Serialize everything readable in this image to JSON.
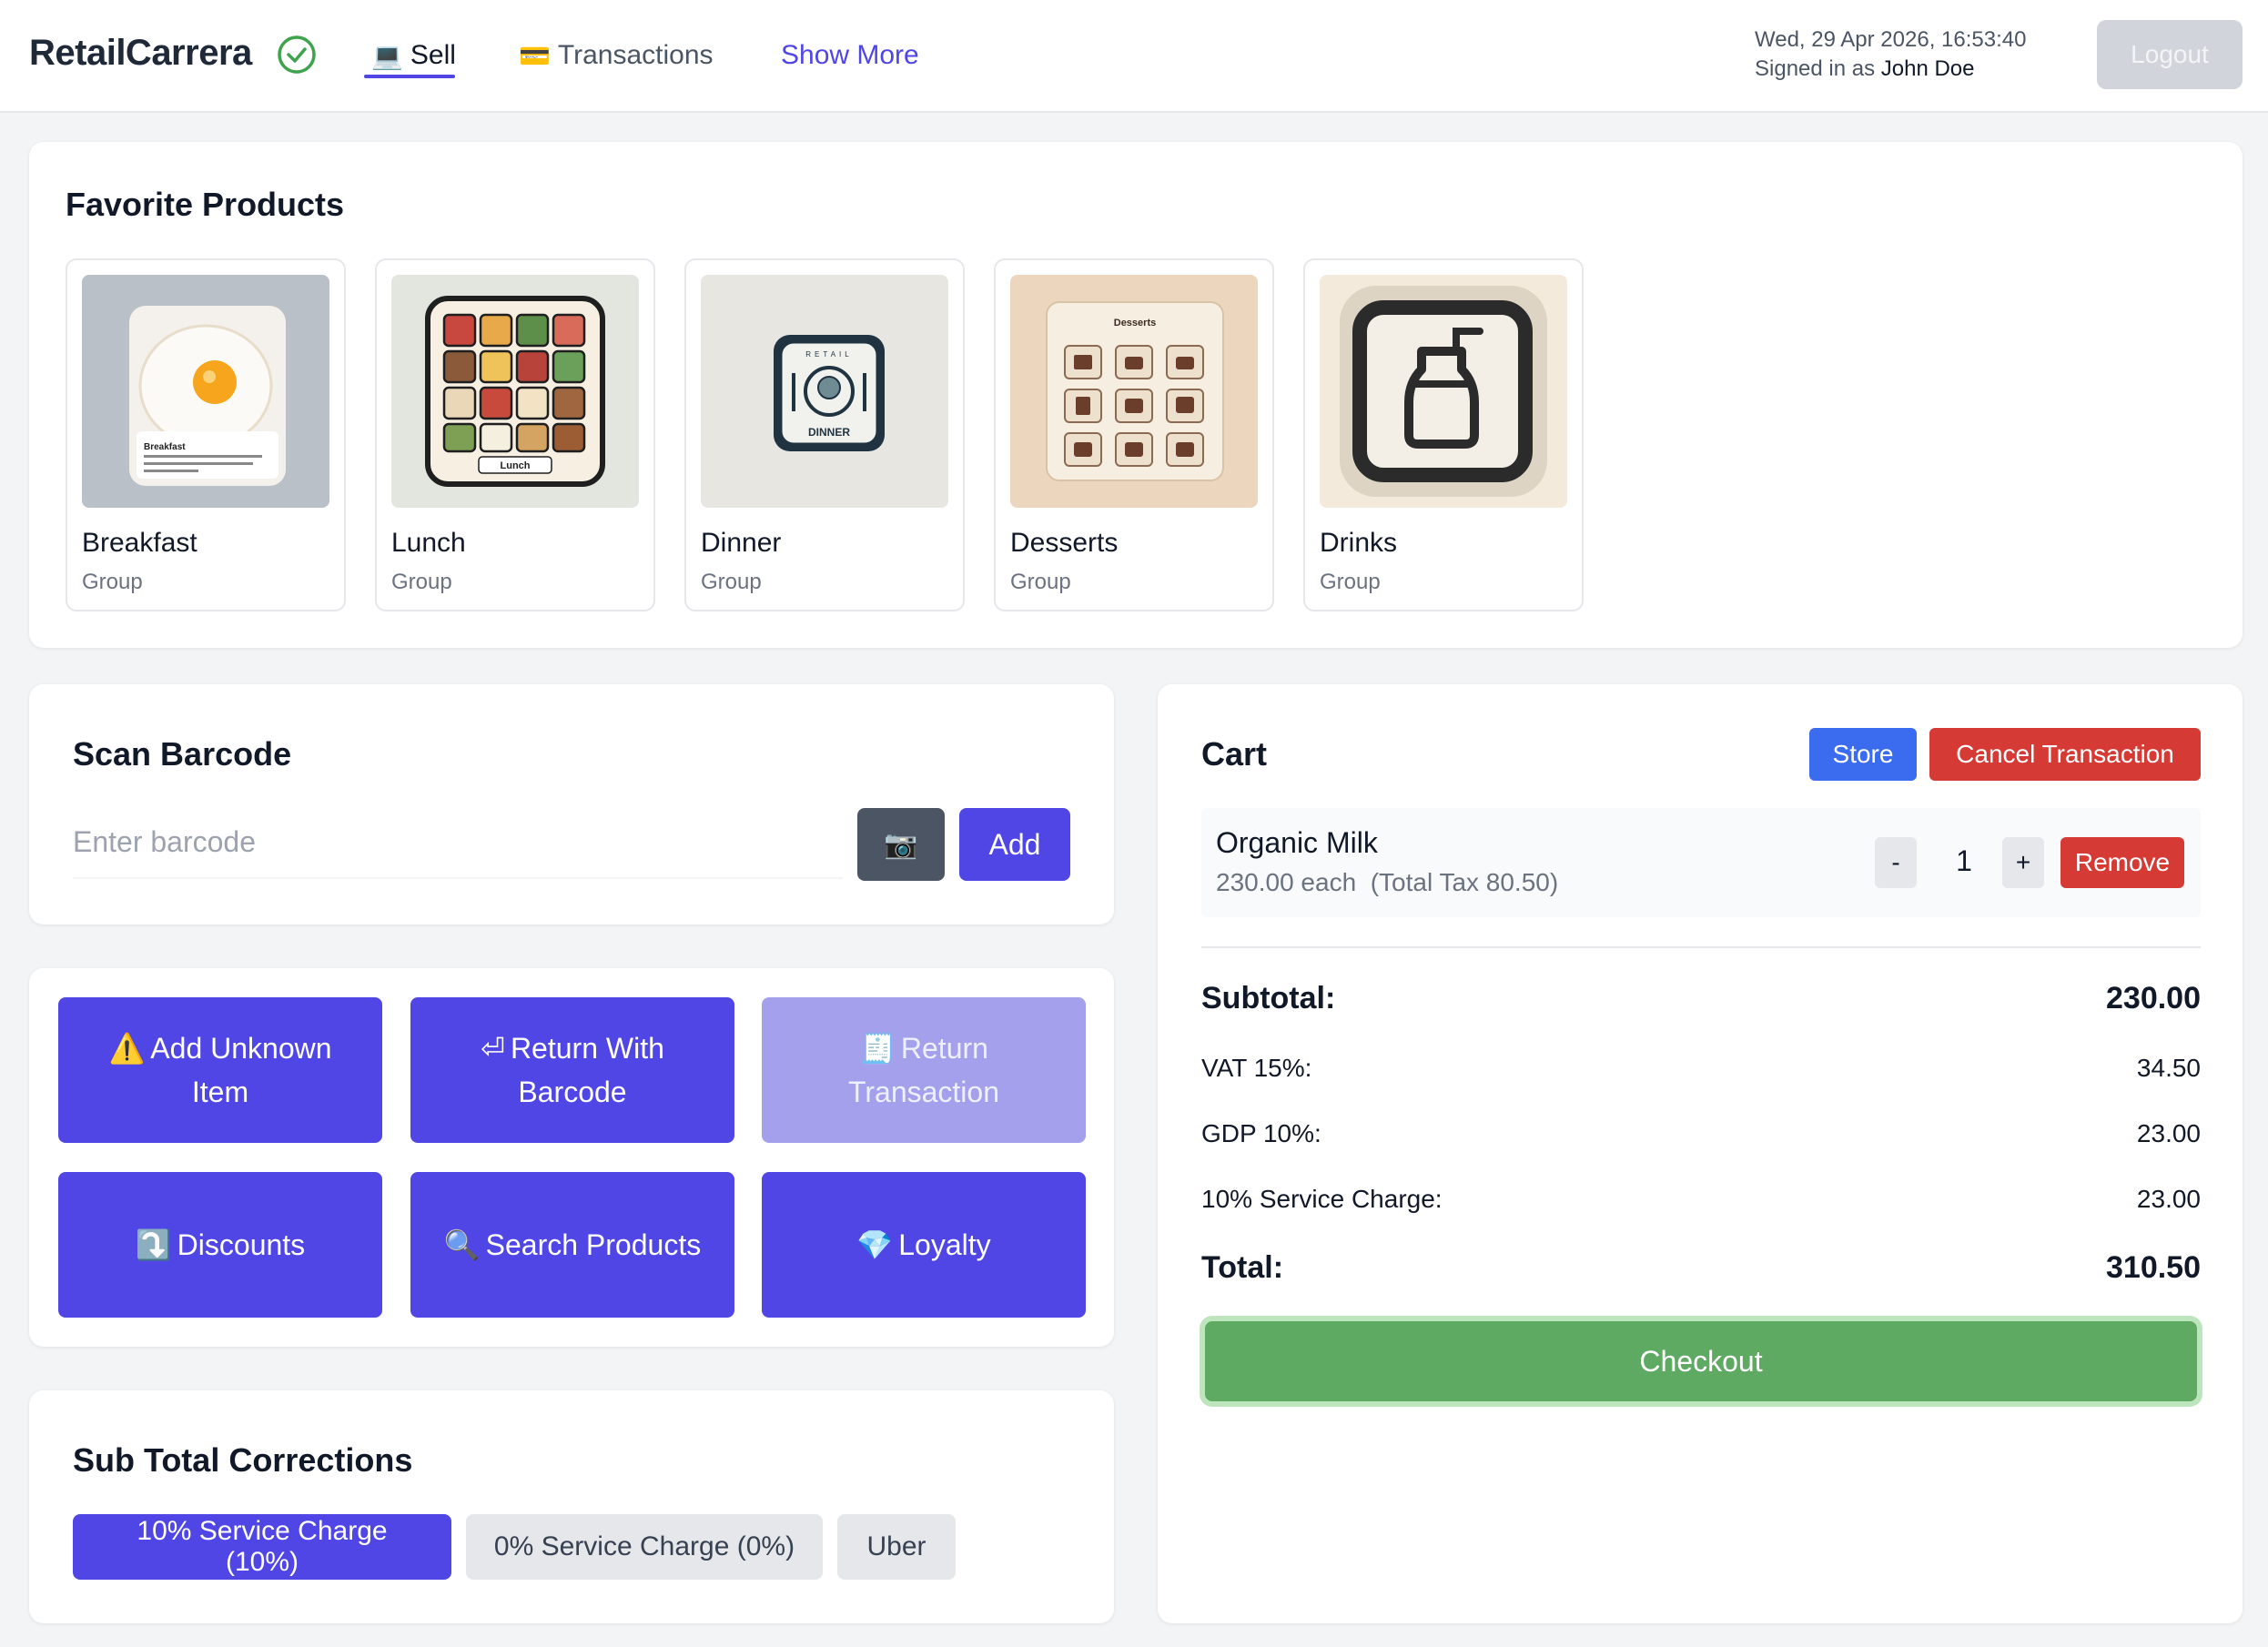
{
  "header": {
    "brand": "RetailCarrera",
    "nav": {
      "sell": {
        "icon": "💻",
        "label": "Sell"
      },
      "transactions": {
        "icon": "💳",
        "label": "Transactions"
      },
      "more": "Show More"
    },
    "datetime": "Wed, 29 Apr 2026, 16:53:40",
    "signed_prefix": "Signed in as",
    "user": "John Doe",
    "logout": "Logout"
  },
  "favorites": {
    "title": "Favorite Products",
    "items": [
      {
        "name": "Breakfast",
        "type": "Group"
      },
      {
        "name": "Lunch",
        "type": "Group"
      },
      {
        "name": "Dinner",
        "type": "Group"
      },
      {
        "name": "Desserts",
        "type": "Group"
      },
      {
        "name": "Drinks",
        "type": "Group"
      }
    ],
    "image_text": {
      "breakfast": "Breakfast",
      "lunch": "Lunch",
      "dinner_top": "RETAIL",
      "dinner": "DINNER",
      "desserts": "Desserts"
    }
  },
  "scan": {
    "title": "Scan Barcode",
    "placeholder": "Enter barcode",
    "camera_icon": "📷",
    "add": "Add"
  },
  "actions": [
    {
      "icon": "⚠️",
      "label": "Add Unknown Item"
    },
    {
      "icon": "⏎",
      "label": "Return With Barcode"
    },
    {
      "icon": "🧾",
      "label": "Return Transaction",
      "disabled": true
    },
    {
      "icon": "⤵️",
      "label": "Discounts"
    },
    {
      "icon": "🔍",
      "label": "Search Products"
    },
    {
      "icon": "💎",
      "label": "Loyalty"
    }
  ],
  "corrections": {
    "title": "Sub Total Corrections",
    "options": [
      {
        "label": "10% Service Charge (10%)",
        "active": true
      },
      {
        "label": "0% Service Charge (0%)",
        "active": false
      },
      {
        "label": "Uber",
        "active": false
      }
    ]
  },
  "cart": {
    "title": "Cart",
    "store": "Store",
    "cancel": "Cancel Transaction",
    "items": [
      {
        "name": "Organic Milk",
        "price_line": "230.00 each  (Total Tax 80.50)",
        "qty": "1",
        "minus": "-",
        "plus": "+",
        "remove": "Remove"
      }
    ],
    "summary": {
      "subtotal": {
        "label": "Subtotal:",
        "value": "230.00"
      },
      "vat": {
        "label": "VAT 15%:",
        "value": "34.50"
      },
      "gdp": {
        "label": "GDP 10%:",
        "value": "23.00"
      },
      "service": {
        "label": "10% Service Charge:",
        "value": "23.00"
      },
      "total": {
        "label": "Total:",
        "value": "310.50"
      }
    },
    "checkout": "Checkout"
  },
  "colors": {
    "accent": "#4f46e5",
    "danger": "#d63a34",
    "store": "#3b6cf0",
    "checkout": "#5faa63",
    "success_check": "#3fa34d"
  }
}
